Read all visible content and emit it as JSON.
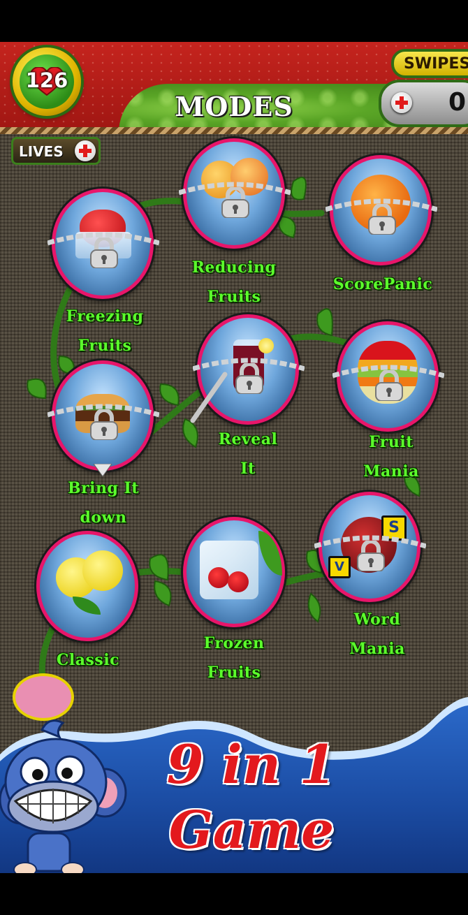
{
  "header": {
    "title": "MODES",
    "lives": "126",
    "lives_label": "LIVES",
    "swipes_label": "SWIPES",
    "swipes_value": "0"
  },
  "modes": [
    {
      "label": "FREEZING FRUITS",
      "lines": [
        "Freezing",
        "Fruits"
      ],
      "locked": true,
      "fruit": "strawberry-icon"
    },
    {
      "label": "REDUCING FRUITS",
      "lines": [
        "Reducing",
        "Fruits"
      ],
      "locked": true,
      "fruit": "peaches-icon"
    },
    {
      "label": "SCOREPANIC",
      "lines": [
        "ScorePanic"
      ],
      "locked": true,
      "fruit": "orange-icon"
    },
    {
      "label": "BRING IT DOWN",
      "lines": [
        "Bring It",
        "down"
      ],
      "locked": true,
      "fruit": "burger-icon"
    },
    {
      "label": "REVEAL IT",
      "lines": [
        "Reveal",
        "It"
      ],
      "locked": true,
      "fruit": "juice-glass-icon"
    },
    {
      "label": "FRUIT MANIA",
      "lines": [
        "Fruit",
        "Mania"
      ],
      "locked": true,
      "fruit": "sliced-apple-icon"
    },
    {
      "label": "CLASSIC",
      "lines": [
        "Classic"
      ],
      "locked": false,
      "fruit": "lemons-icon"
    },
    {
      "label": "FROZEN FRUITS",
      "lines": [
        "Frozen",
        "Fruits"
      ],
      "locked": false,
      "fruit": "ice-cherries-icon"
    },
    {
      "label": "WORD MANIA",
      "lines": [
        "Word",
        "Mania"
      ],
      "locked": true,
      "fruit": "letter-apple-icon",
      "tiles": [
        "S",
        "V"
      ]
    }
  ],
  "promo": {
    "line1": "9 in 1",
    "line2": "Game"
  },
  "colors": {
    "ring_border": "#e8156a",
    "label_green": "#5cff2c",
    "promo_red": "#e3191d",
    "wave_blue": "#1a4aa0"
  }
}
